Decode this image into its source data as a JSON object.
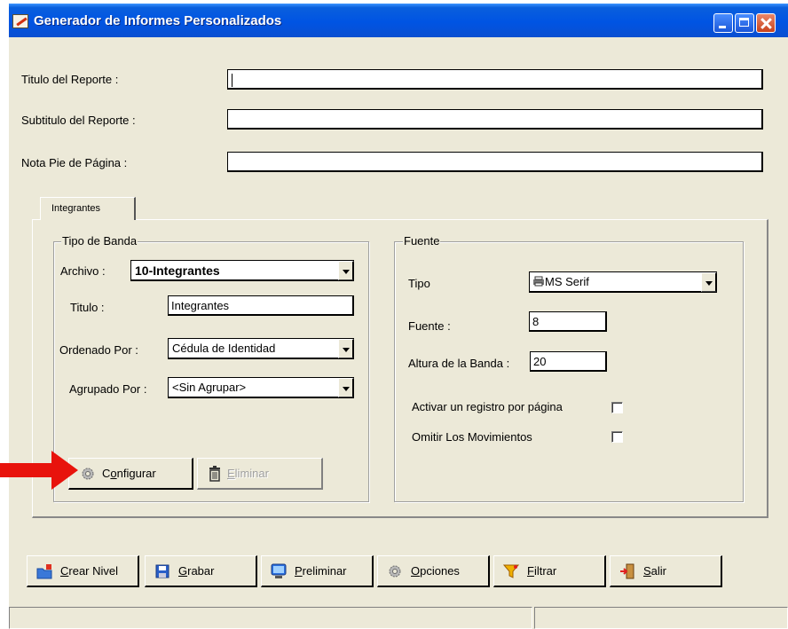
{
  "window": {
    "title": "Generador de Informes Personalizados"
  },
  "report": {
    "titulo_label": "Titulo del Reporte :",
    "titulo_value": "",
    "subtitulo_label": "Subtitulo del Reporte :",
    "subtitulo_value": "",
    "nota_label": "Nota Pie de Página :",
    "nota_value": ""
  },
  "tabs": [
    {
      "label": "Integrantes",
      "active": true
    }
  ],
  "tipo_banda": {
    "legend": "Tipo de Banda",
    "archivo_label": "Archivo :",
    "archivo_value": "10-Integrantes",
    "titulo_label": "Titulo :",
    "titulo_value": "Integrantes",
    "ordenado_label": "Ordenado Por :",
    "ordenado_value": "Cédula de Identidad",
    "agrupado_label": "Agrupado Por :",
    "agrupado_value": "<Sin Agrupar>",
    "configurar_label": "Configurar",
    "eliminar_label": "Eliminar"
  },
  "fuente": {
    "legend": "Fuente",
    "tipo_label": "Tipo",
    "tipo_value": "MS Serif",
    "fuente_label": "Fuente :",
    "fuente_value": "8",
    "altura_label": "Altura de la Banda :",
    "altura_value": "20",
    "activar_label": "Activar un registro por página",
    "activar_checked": false,
    "omitir_label": "Omitir Los Movimientos",
    "omitir_checked": false
  },
  "toolbar": {
    "crear_nivel": "Crear Nivel",
    "grabar": "Grabar",
    "preliminar": "Preliminar",
    "opciones": "Opciones",
    "filtrar": "Filtrar",
    "salir": "Salir"
  },
  "colors": {
    "titlebar": "#0054e3",
    "face": "#ece9d8",
    "annotation_arrow": "#e8130c"
  }
}
